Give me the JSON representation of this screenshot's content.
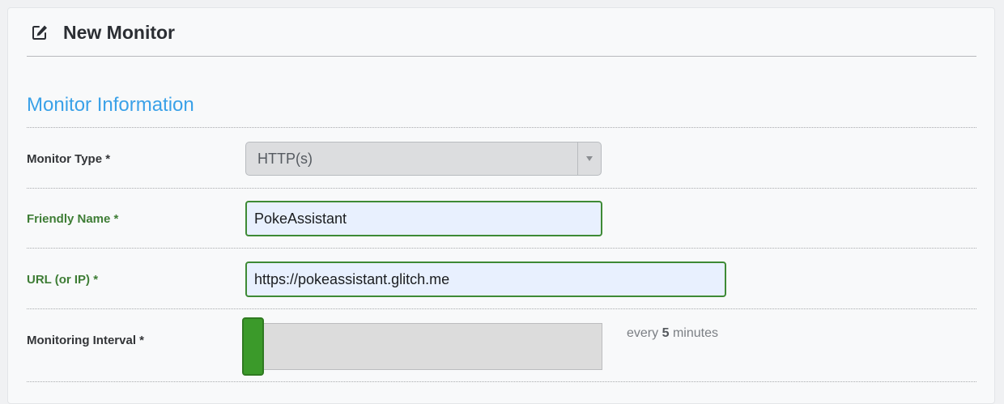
{
  "header": {
    "title": "New Monitor",
    "icon": "edit-icon"
  },
  "section": {
    "title": "Monitor Information"
  },
  "fields": {
    "monitor_type": {
      "label": "Monitor Type *",
      "value": "HTTP(s)"
    },
    "friendly_name": {
      "label": "Friendly Name *",
      "value": "PokeAssistant"
    },
    "url": {
      "label": "URL (or IP) *",
      "value": "https://pokeassistant.glitch.me"
    },
    "interval": {
      "label": "Monitoring Interval *",
      "prefix": "every",
      "value": "5",
      "suffix": "minutes",
      "slider_fraction": 0
    }
  },
  "colors": {
    "accent_blue": "#3aa1e8",
    "valid_green": "#3e8a35",
    "slider_green": "#3b9a2a",
    "input_autofill_bg": "#e8f0fe"
  }
}
